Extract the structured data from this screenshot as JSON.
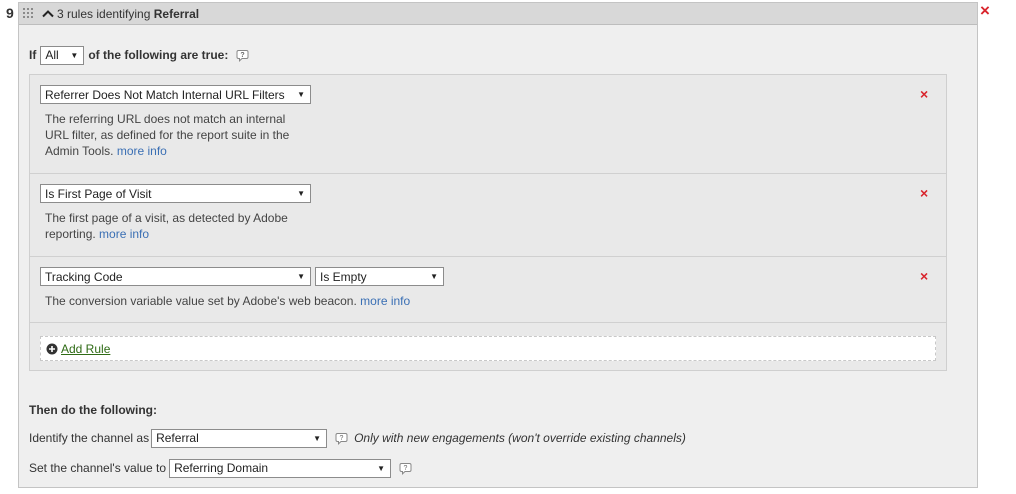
{
  "rule_number": "9",
  "header": {
    "summary_prefix": "3 rules identifying",
    "channel_name": "Referral"
  },
  "condition": {
    "if_label": "If",
    "match_select": "All",
    "suffix": "of the following are true:"
  },
  "rules": [
    {
      "select": "Referrer Does Not Match Internal URL Filters",
      "description": "The referring URL does not match an internal URL filter, as defined for the report suite in the Admin Tools.",
      "more_info": "more info"
    },
    {
      "select": "Is First Page of Visit",
      "description": "The first page of a visit, as detected by Adobe reporting.",
      "more_info": "more info"
    },
    {
      "select": "Tracking Code",
      "operator": "Is Empty",
      "description": "The conversion variable value set by Adobe's web beacon.",
      "more_info": "more info"
    }
  ],
  "add_rule_label": "Add Rule",
  "then": {
    "title": "Then do the following:",
    "identify_label": "Identify the channel as",
    "identify_value": "Referral",
    "identify_note": "Only with new engagements (won't override existing channels)",
    "value_label": "Set the channel's value to",
    "value_select": "Referring Domain"
  },
  "colors": {
    "remove": "#d9242c",
    "link": "#3a6fb4",
    "add_rule": "#2e6a14"
  },
  "icons": {
    "remove": "×",
    "help": "question-bubble-icon",
    "add": "plus-circle-icon",
    "collapse": "chevron-up-icon",
    "drag": "drag-handle-icon"
  }
}
